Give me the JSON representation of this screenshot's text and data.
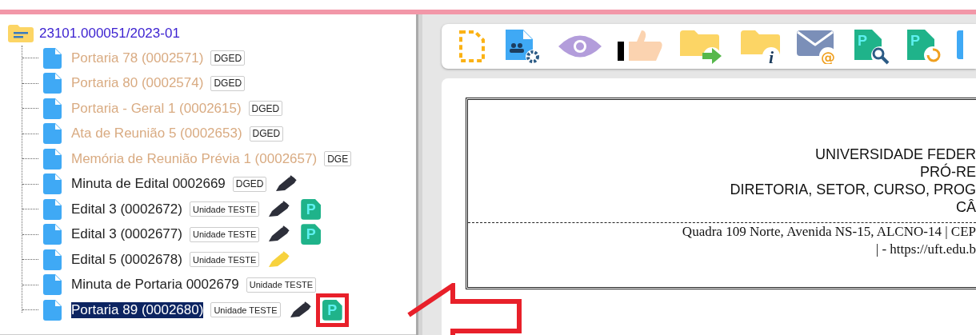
{
  "tree": {
    "root": {
      "label": "23101.000051/2023-01",
      "expanded": true
    },
    "items": [
      {
        "label": "Portaria 78 (0002571)",
        "unit": "DGED",
        "dimmed": true,
        "pen": false,
        "selected": false
      },
      {
        "label": "Portaria 80 (0002574)",
        "unit": "DGED",
        "dimmed": true,
        "pen": false,
        "selected": false
      },
      {
        "label": "Portaria - Geral 1 (0002615)",
        "unit": "DGED",
        "dimmed": true,
        "pen": false,
        "selected": false
      },
      {
        "label": "Ata de Reunião 5 (0002653)",
        "unit": "DGED",
        "dimmed": true,
        "pen": false,
        "selected": false
      },
      {
        "label": "Memória de Reunião Prévia 1 (0002657)",
        "unit": "DGE",
        "dimmed": true,
        "pen": false,
        "selected": false
      },
      {
        "label": "Minuta de Edital 0002669",
        "unit": "DGED",
        "dimmed": false,
        "pen": true,
        "pen_pending": false,
        "selected": false
      },
      {
        "label": "Edital 3 (0002672)",
        "unit": "Unidade TESTE",
        "dimmed": false,
        "pen": true,
        "pen_pending": false,
        "publication": "P",
        "selected": false,
        "highlighted": false
      },
      {
        "label": "Edital 3 (0002677)",
        "unit": "Unidade TESTE",
        "dimmed": false,
        "pen": true,
        "pen_pending": false,
        "publication": "P",
        "selected": false,
        "highlighted": false
      },
      {
        "label": "Edital 5 (0002678)",
        "unit": "Unidade TESTE",
        "dimmed": false,
        "pen": true,
        "pen_pending": true,
        "selected": false
      },
      {
        "label": "Minuta de Portaria 0002679",
        "unit": "Unidade TESTE",
        "dimmed": false,
        "pen": false,
        "selected": false
      },
      {
        "label": "Portaria 89 (0002680)",
        "unit": "Unidade TESTE",
        "dimmed": false,
        "pen": true,
        "pen_pending": false,
        "publication": "P",
        "selected": true,
        "highlighted": true
      }
    ]
  },
  "toolbar": [
    {
      "kind": "new-document"
    },
    {
      "kind": "document-users"
    },
    {
      "kind": "view"
    },
    {
      "kind": "approve"
    },
    {
      "kind": "move-folder"
    },
    {
      "kind": "folder-info",
      "glyph": "i"
    },
    {
      "kind": "email",
      "glyph": "@"
    },
    {
      "kind": "publication-search",
      "glyph": "P"
    },
    {
      "kind": "publication-refresh",
      "glyph": "P"
    },
    {
      "kind": "partial"
    }
  ],
  "document": {
    "header_lines": [
      "UNIVERSIDADE FEDER",
      "PRÓ-RE",
      "DIRETORIA, SETOR, CURSO, PROG",
      "CÂ"
    ],
    "address_lines": [
      "Quadra 109 Norte, Avenida NS-15, ALCNO-14 | CEP",
      "| - https://uft.edu.b"
    ]
  }
}
